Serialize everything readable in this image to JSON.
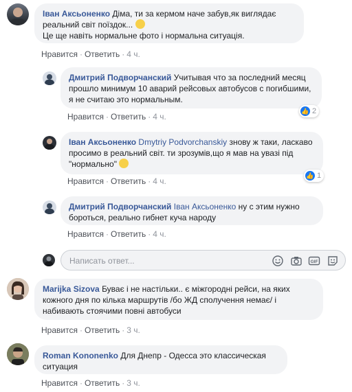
{
  "comments": [
    {
      "author": "Іван Аксьоненко",
      "text": "Діма, ти за кермом наче забув,як виглядає реальний світ поїздок...",
      "text2": "Це ще навіть нормальне фото і нормальна ситуація.",
      "like": "Нравится",
      "reply": "Ответить",
      "time": "4 ч."
    },
    {
      "author": "Дмитрий Подворчанский",
      "text": "Учитывая что за последний месяц прошло минимум 10 аварий рейсовых автобусов с погибшими, я не считаю это нормальным.",
      "like": "Нравится",
      "reply": "Ответить",
      "time": "4 ч.",
      "reactions": "2"
    },
    {
      "author": "Іван Аксьоненко",
      "mention": "Dmytriy Podvorchanskiy",
      "text": "знову ж таки, ласкаво просимо в реальний світ. ти зрозумів,що я мав на увазі під \"нормально\"",
      "like": "Нравится",
      "reply": "Ответить",
      "time": "4 ч.",
      "reactions": "1"
    },
    {
      "author": "Дмитрий Подворчанский",
      "mention": "Іван Аксьоненко",
      "text": "ну с этим нужно бороться, реально гибнет куча народу",
      "like": "Нравится",
      "reply": "Ответить",
      "time": "4 ч."
    },
    {
      "author": "Marijka Sizova",
      "text": "Буває і не настільки.. є міжгородні рейси, на яких кожного дня по кілька маршрутів /бо ЖД сполучення немає/ і набивають стоячими повні автобуси",
      "like": "Нравится",
      "reply": "Ответить",
      "time": "3 ч."
    },
    {
      "author": "Roman Kononenko",
      "text": "Для Днепр - Одесса это классическая ситуация",
      "like": "Нравится",
      "reply": "Ответить",
      "time": "3 ч."
    }
  ],
  "reply_box": {
    "placeholder": "Написать ответ..."
  },
  "colors": {
    "link": "#385898",
    "bubble": "#f2f3f5",
    "meta": "#90949c",
    "like_blue": "#1877f2"
  }
}
